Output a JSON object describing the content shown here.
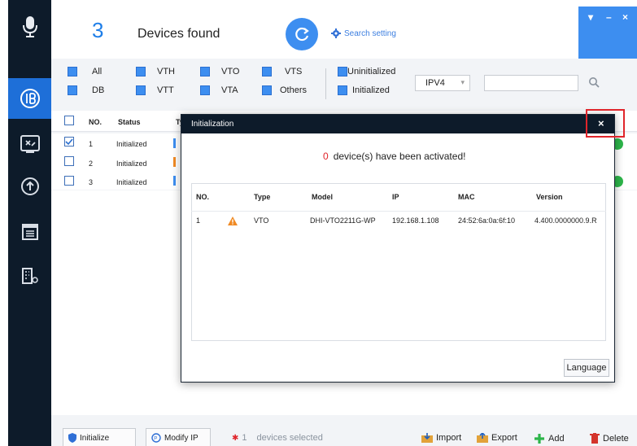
{
  "header": {
    "count": "3",
    "title": "Devices found",
    "search_setting": "Search setting",
    "window_controls": [
      "▾",
      "–",
      "×"
    ]
  },
  "filters": {
    "row1": [
      {
        "label": "All",
        "checked": true
      },
      {
        "label": "VTH",
        "checked": true
      },
      {
        "label": "VTO",
        "checked": true
      },
      {
        "label": "VTS",
        "checked": true
      },
      {
        "label": "Uninitialized",
        "checked": true
      }
    ],
    "row2": [
      {
        "label": "DB",
        "checked": true
      },
      {
        "label": "VTT",
        "checked": true
      },
      {
        "label": "VTA",
        "checked": true
      },
      {
        "label": "Others",
        "checked": true
      },
      {
        "label": "Initialized",
        "checked": true
      }
    ],
    "ip_version": "IPV4",
    "search_value": ""
  },
  "device_table": {
    "headers": [
      "NO.",
      "Status",
      "Ty"
    ],
    "rows": [
      {
        "no": "1",
        "status": "Initialized",
        "checked": true,
        "type_color": "#3d8ef0"
      },
      {
        "no": "2",
        "status": "Initialized",
        "checked": false,
        "type_color": "#f08a24"
      },
      {
        "no": "3",
        "status": "Initialized",
        "checked": false,
        "type_color": "#3d8ef0"
      }
    ]
  },
  "modal": {
    "title": "Initialization",
    "close": "×",
    "activated_count": "0",
    "activated_text": "device(s) have been activated!",
    "headers": [
      "NO.",
      "Type",
      "Model",
      "IP",
      "MAC",
      "Version"
    ],
    "row": {
      "no": "1",
      "type": "VTO",
      "model": "DHI-VTO2211G-WP",
      "ip": "192.168.1.108",
      "mac": "24:52:6a:0a:6f:10",
      "version": "4.400.0000000.9.R"
    },
    "language_button": "Language"
  },
  "footer": {
    "initialize": "Initialize",
    "modify_ip": "Modify IP",
    "selected_count": "1",
    "selected_text": "devices selected",
    "import": "Import",
    "export": "Export",
    "add": "Add",
    "delete": "Delete"
  },
  "colors": {
    "sidebar": "#0d1b2a",
    "accent": "#3d8ef0",
    "highlight_box": "#e0252b",
    "status_online": "#2db54a",
    "warning": "#f08a24"
  }
}
